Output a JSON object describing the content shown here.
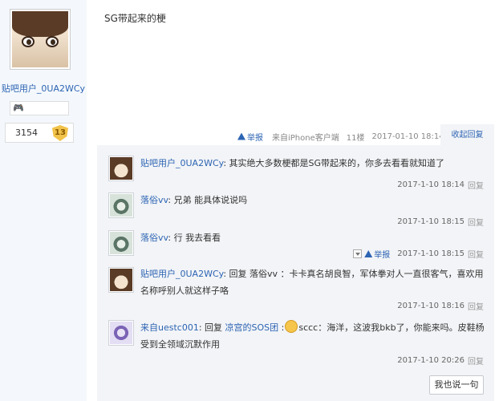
{
  "author": {
    "name": "贴吧用户_0UA2WCy",
    "badge": "🎮",
    "exp": "3154",
    "level": "13"
  },
  "post": {
    "content": "SG带起来的梗",
    "report": "举报",
    "source": "来自iPhone客户端",
    "floor": "11楼",
    "time": "2017-01-10 18:14",
    "collapse": "收起回复"
  },
  "replies": [
    {
      "user": "贴吧用户_0UA2WCy",
      "text": ": 其实绝大多数梗都是SG带起来的，你多去看看就知道了",
      "time": "2017-1-10 18:14",
      "reply": "回复"
    },
    {
      "user": "落俗vv",
      "text": ": 兄弟 能具体说说吗",
      "time": "2017-1-10 18:15",
      "reply": "回复"
    },
    {
      "user": "落俗vv",
      "text": ": 行 我去看看",
      "time": "2017-1-10 18:15",
      "reply": "回复",
      "report": "举报"
    },
    {
      "user": "贴吧用户_0UA2WCy",
      "text": ": 回复 落俗vv ：卡卡真名胡良智，军体拳对人一直很客气，喜欢用名称呼别人就这样子咯",
      "time": "2017-1-10 18:16",
      "reply": "回复"
    },
    {
      "user": "来自uestc001",
      "text_pre": ": 回复 ",
      "mention": "凉宫的SOS团",
      "text_mid": " :",
      "text_post": "sccc：海洋，这波我bkb了，你能来吗。皮鞋杨受到全领域沉默作用",
      "time": "2017-1-10 20:26",
      "reply": "回复"
    }
  ],
  "say_button": "我也说一句",
  "icons": {
    "report": "warning-triangle-icon",
    "emoji": "smiley-emoji-icon",
    "dropdown": "dropdown-icon"
  }
}
